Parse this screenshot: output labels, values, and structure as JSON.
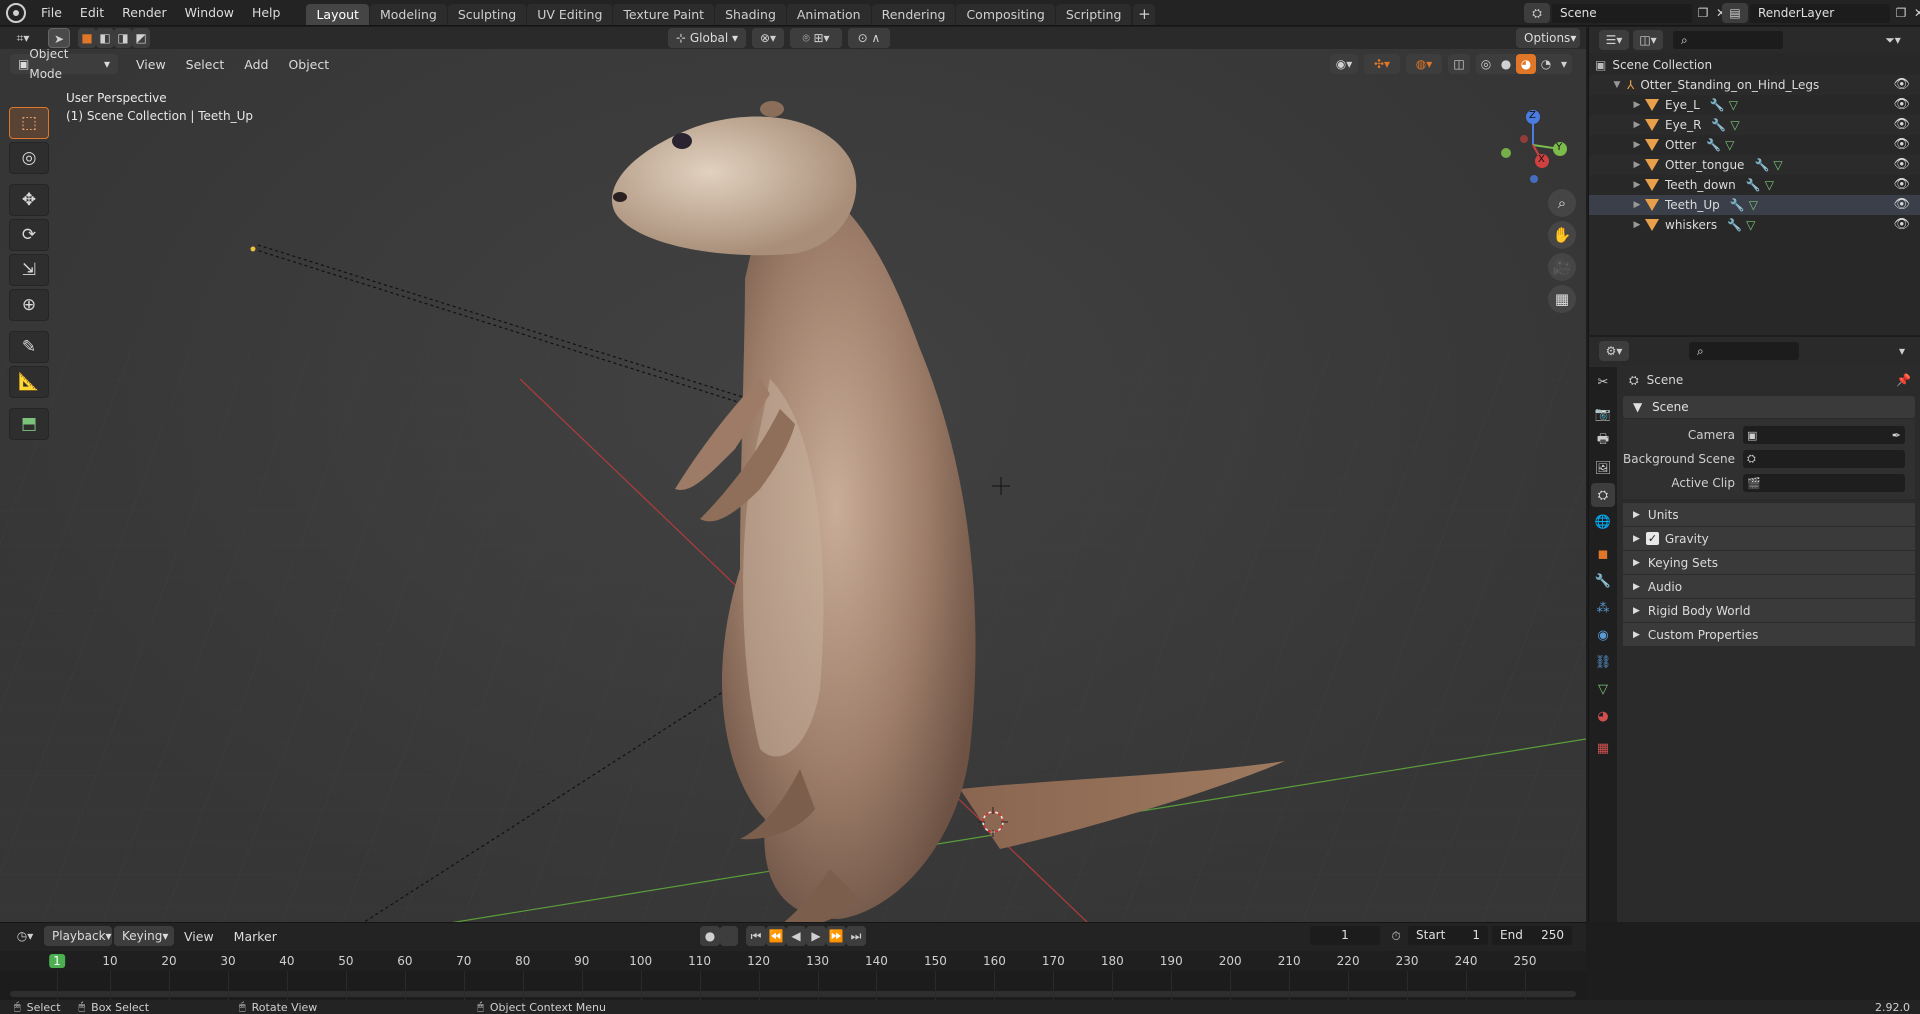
{
  "topbar": {
    "menus": [
      "File",
      "Edit",
      "Render",
      "Window",
      "Help"
    ],
    "workspaces": [
      "Layout",
      "Modeling",
      "Sculpting",
      "UV Editing",
      "Texture Paint",
      "Shading",
      "Animation",
      "Rendering",
      "Compositing",
      "Scripting"
    ],
    "active_workspace": "Layout",
    "add_workspace": "+",
    "scene": "Scene",
    "view_layer": "RenderLayer"
  },
  "toolheader": {
    "orientation": "Global",
    "options": "Options"
  },
  "viewport": {
    "mode": "Object Mode",
    "menus": [
      "View",
      "Select",
      "Add",
      "Object"
    ],
    "info_line1": "User Perspective",
    "info_line2": "(1) Scene Collection | Teeth_Up",
    "gizmo": {
      "z": "Z",
      "y": "Y",
      "x": "X"
    }
  },
  "outliner": {
    "root": "Scene Collection",
    "collection": "Otter_Standing_on_Hind_Legs",
    "objects": [
      "Eye_L",
      "Eye_R",
      "Otter",
      "Otter_tongue",
      "Teeth_down",
      "Teeth_Up",
      "whiskers"
    ],
    "selected": "Teeth_Up"
  },
  "properties": {
    "context": "Scene",
    "panel": "Scene",
    "fields": [
      {
        "label": "Camera"
      },
      {
        "label": "Background Scene"
      },
      {
        "label": "Active Clip"
      }
    ],
    "subpanels": [
      "Units",
      "Gravity",
      "Keying Sets",
      "Audio",
      "Rigid Body World",
      "Custom Properties"
    ],
    "gravity_checked": true
  },
  "timeline": {
    "menus": [
      "Playback",
      "Keying",
      "View",
      "Marker"
    ],
    "current_frame": "1",
    "start_label": "Start",
    "start": "1",
    "end_label": "End",
    "end": "250",
    "ticks": [
      "1",
      "10",
      "20",
      "30",
      "40",
      "50",
      "60",
      "70",
      "80",
      "90",
      "100",
      "110",
      "120",
      "130",
      "140",
      "150",
      "160",
      "170",
      "180",
      "190",
      "200",
      "210",
      "220",
      "230",
      "240",
      "250"
    ]
  },
  "status": {
    "select": "Select",
    "box_select": "Box Select",
    "rotate_view": "Rotate View",
    "context_menu": "Object Context Menu",
    "version": "2.92.0"
  },
  "colors": {
    "accent_orange": "#e07628",
    "selected_blue": "#334d80",
    "frame_green": "#4caf50",
    "axis_red": "#b23b3b",
    "axis_green": "#5a9e3a"
  }
}
